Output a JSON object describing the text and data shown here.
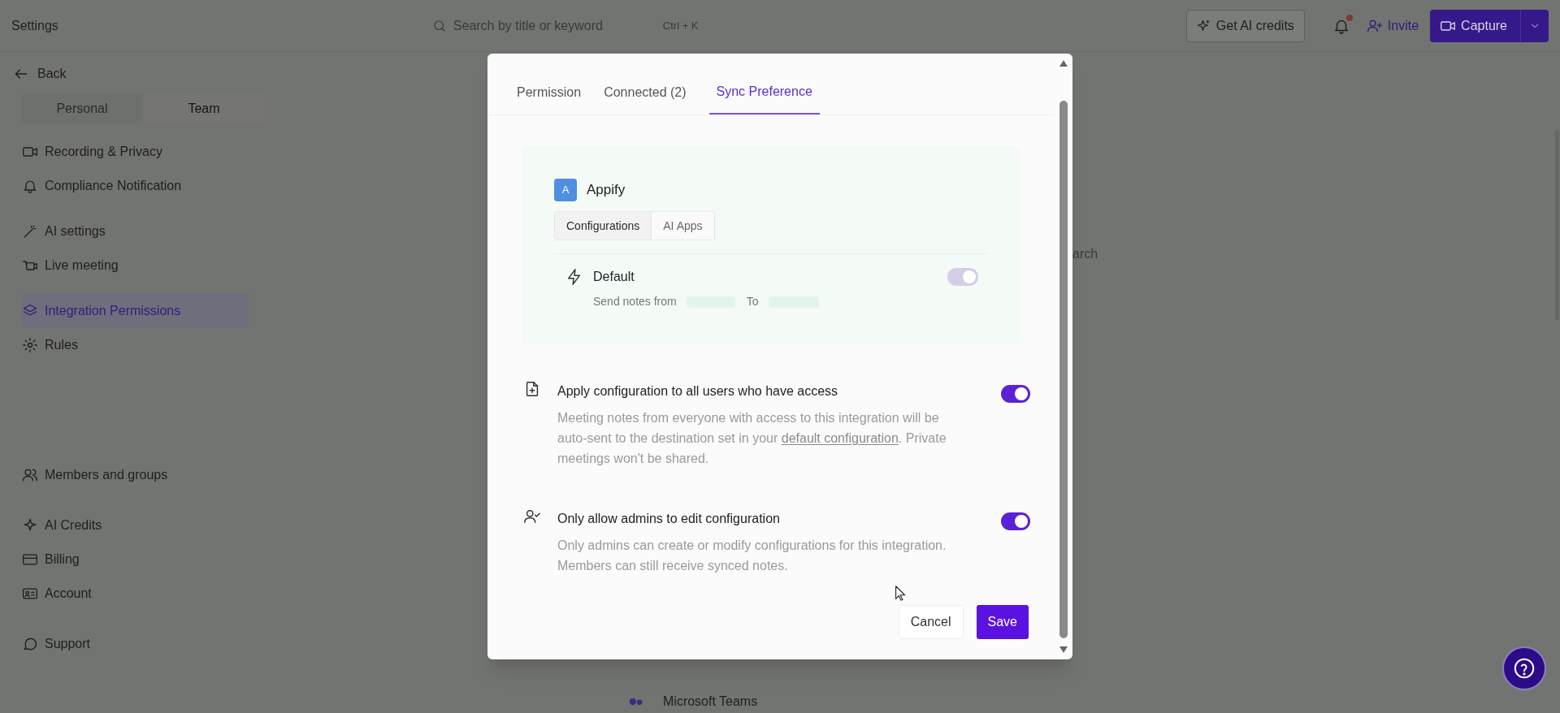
{
  "topbar": {
    "title": "Settings",
    "search": {
      "placeholder": "Search by title or keyword",
      "shortcut": "Ctrl + K"
    },
    "credits_button": "Get AI credits",
    "notification_dot": true,
    "invite_button": "Invite",
    "capture_button": "Capture"
  },
  "sidebar": {
    "back": "Back",
    "scope_tabs": [
      {
        "label": "Personal",
        "selected": false
      },
      {
        "label": "Team",
        "selected": true
      }
    ],
    "groups": [
      [
        {
          "label": "Recording & Privacy",
          "selected": false
        },
        {
          "label": "Compliance Notification",
          "selected": false
        }
      ],
      [
        {
          "label": "AI settings",
          "selected": false
        },
        {
          "label": "Live meeting",
          "selected": false
        }
      ],
      [
        {
          "label": "Integration Permissions",
          "selected": true
        },
        {
          "label": "Rules",
          "selected": false
        }
      ],
      [
        {
          "label": "Members and groups",
          "selected": false
        }
      ],
      [
        {
          "label": "AI Credits",
          "selected": false
        },
        {
          "label": "Billing",
          "selected": false
        },
        {
          "label": "Account",
          "selected": false
        }
      ],
      [
        {
          "label": "Support",
          "selected": false
        }
      ]
    ]
  },
  "background": {
    "search_fragment": "arch",
    "list_item": "Microsoft Teams"
  },
  "modal": {
    "tabs": [
      {
        "label": "Permission",
        "selected": false
      },
      {
        "label": "Connected (2)",
        "selected": false
      },
      {
        "label": "Sync Preference",
        "selected": true
      }
    ],
    "app": {
      "initial": "A",
      "name": "Appify",
      "tabs": [
        {
          "label": "Configurations",
          "selected": true
        },
        {
          "label": "AI Apps",
          "selected": false
        }
      ],
      "config": {
        "name": "Default",
        "from_label": "Send notes from",
        "to_label": "To",
        "on": true,
        "disabled": true
      }
    },
    "options": [
      {
        "title": "Apply configuration to all users who have access",
        "on": true,
        "description": [
          {
            "kind": "text",
            "text": "Meeting notes from everyone with access to this integration will be auto-sent to the destination set in your "
          },
          {
            "kind": "link",
            "text": "default configuration"
          },
          {
            "kind": "text",
            "text": ". Private meetings won't be shared."
          }
        ]
      },
      {
        "title": "Only allow admins to edit configuration",
        "on": true,
        "description": [
          {
            "kind": "text",
            "text": "Only admins can create or modify configurations for this integration. Members can still receive synced notes."
          }
        ]
      }
    ],
    "buttons": {
      "cancel": "Cancel",
      "save": "Save"
    }
  }
}
